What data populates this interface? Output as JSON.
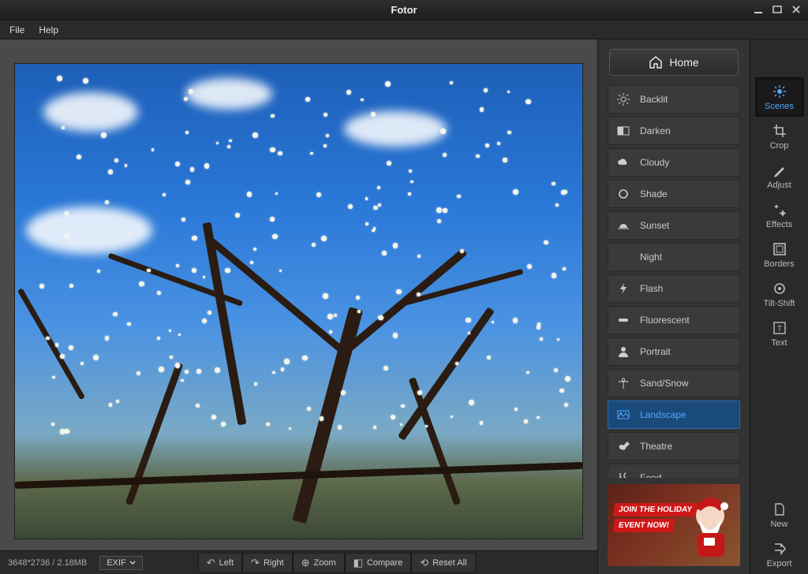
{
  "app_title": "Fotor",
  "menu": {
    "file": "File",
    "help": "Help"
  },
  "image_info": "3648*2736 / 2.18MB",
  "exif_label": "EXIF",
  "bottom_tools": {
    "left": "Left",
    "right": "Right",
    "zoom": "Zoom",
    "compare": "Compare",
    "reset_all": "Reset All"
  },
  "home_label": "Home",
  "scenes": [
    {
      "label": "Backlit",
      "icon": "sun-burst"
    },
    {
      "label": "Darken",
      "icon": "darken"
    },
    {
      "label": "Cloudy",
      "icon": "cloud"
    },
    {
      "label": "Shade",
      "icon": "circle"
    },
    {
      "label": "Sunset",
      "icon": "sunset"
    },
    {
      "label": "Night",
      "icon": "moon"
    },
    {
      "label": "Flash",
      "icon": "bolt"
    },
    {
      "label": "Fluorescent",
      "icon": "tube"
    },
    {
      "label": "Portrait",
      "icon": "person"
    },
    {
      "label": "Sand/Snow",
      "icon": "palm"
    },
    {
      "label": "Landscape",
      "icon": "landscape",
      "selected": true
    },
    {
      "label": "Theatre",
      "icon": "guitar"
    },
    {
      "label": "Food",
      "icon": "utensils"
    }
  ],
  "tool_tabs": [
    {
      "label": "Scenes",
      "active": true
    },
    {
      "label": "Crop"
    },
    {
      "label": "Adjust"
    },
    {
      "label": "Effects"
    },
    {
      "label": "Borders"
    },
    {
      "label": "Tilt-Shift"
    },
    {
      "label": "Text"
    }
  ],
  "tool_tabs_bottom": [
    {
      "label": "New"
    },
    {
      "label": "Export"
    }
  ],
  "ad": {
    "line1": "JOIN THE HOLIDAY",
    "line2": "EVENT NOW!"
  }
}
